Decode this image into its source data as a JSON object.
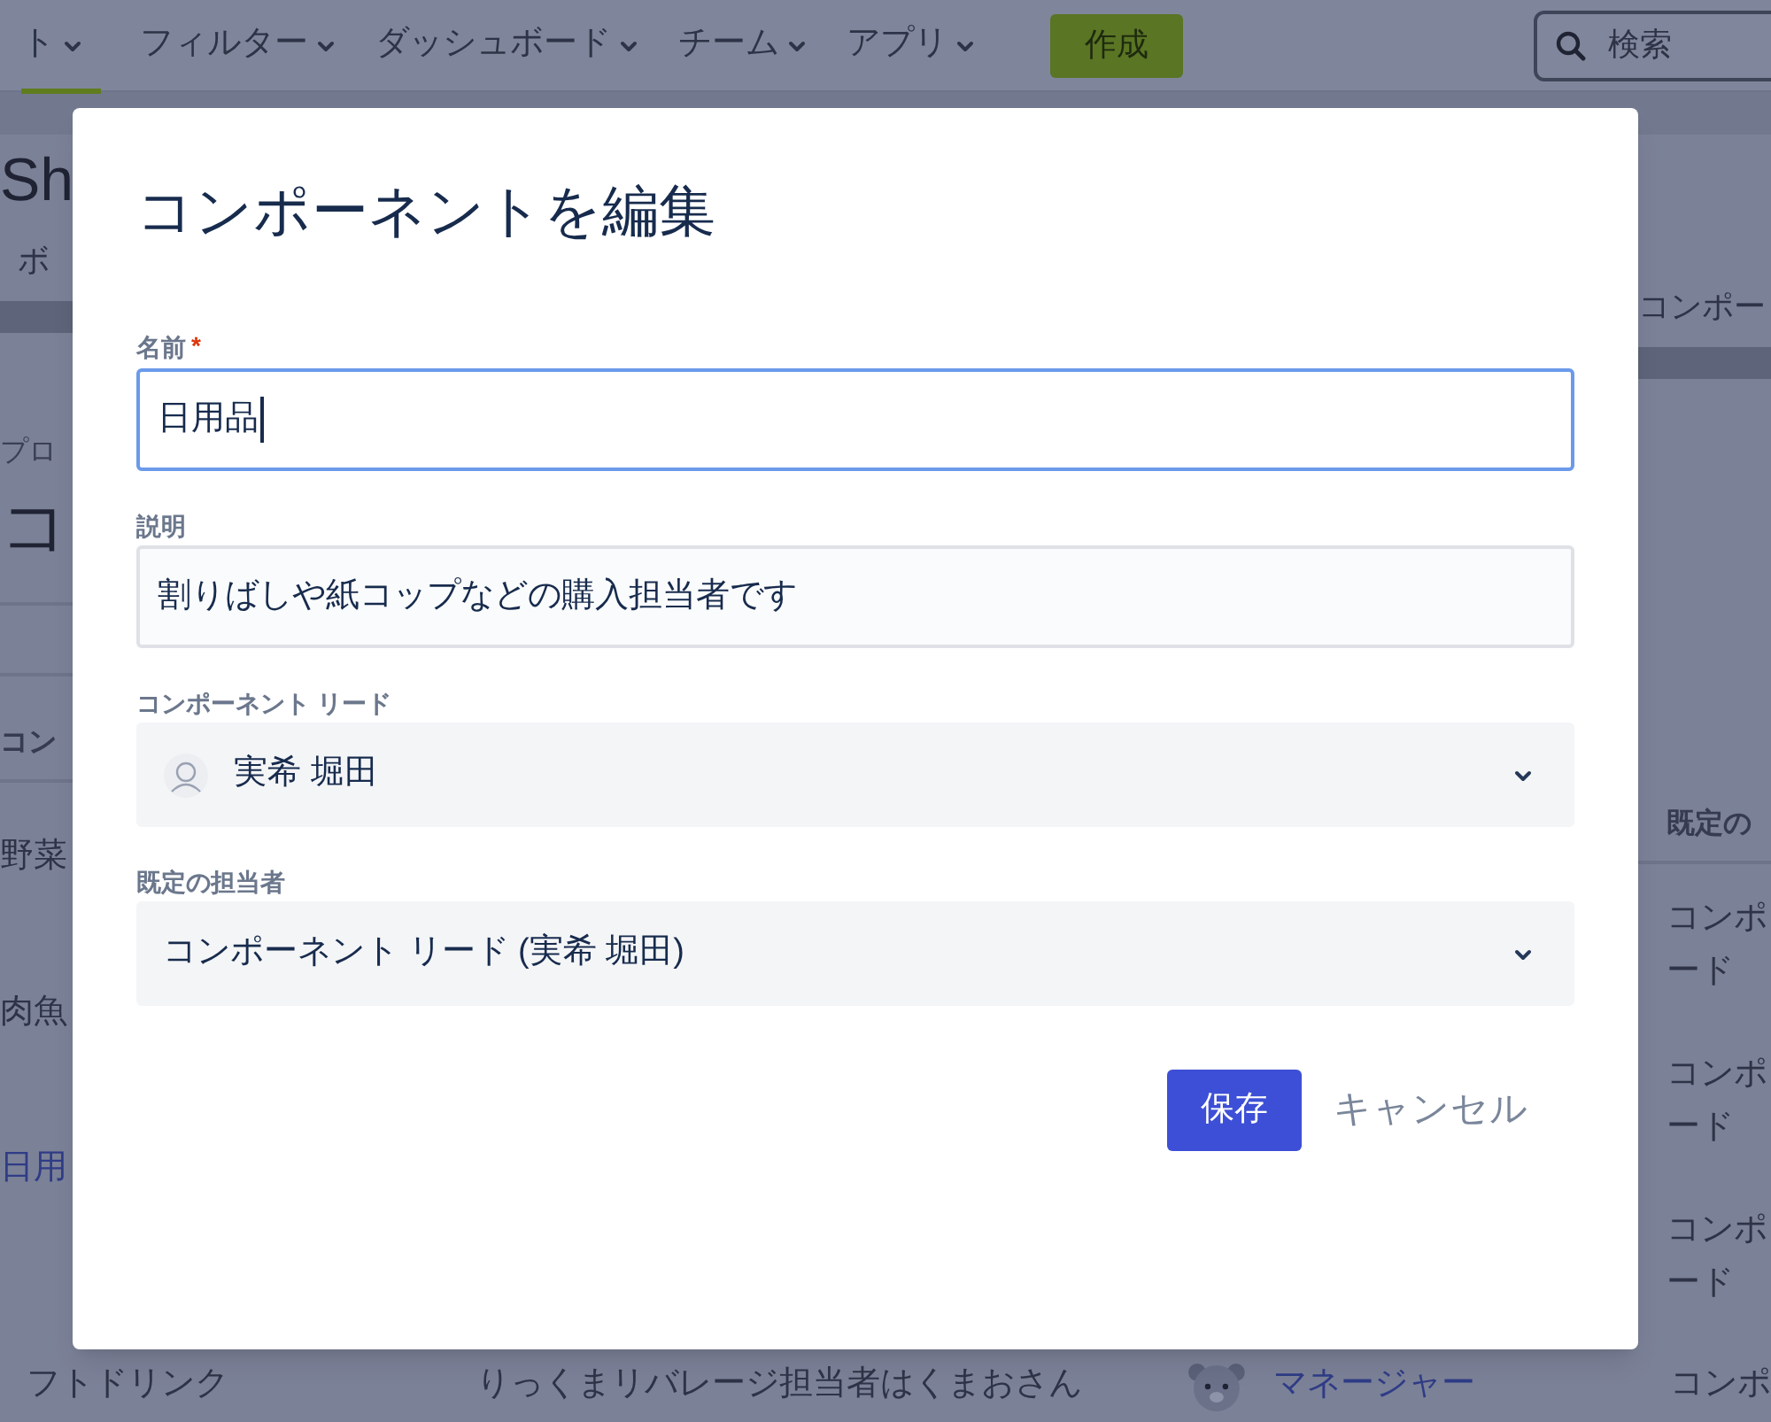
{
  "nav": {
    "items": [
      {
        "label": "ト",
        "selected": true
      },
      {
        "label": "フィルター",
        "selected": false
      },
      {
        "label": "ダッシュボード",
        "selected": false
      },
      {
        "label": "チーム",
        "selected": false
      },
      {
        "label": "アプリ",
        "selected": false
      }
    ],
    "create_button": "作成",
    "search": {
      "placeholder": "検索"
    }
  },
  "page": {
    "title": "Sh",
    "tab": "ボ",
    "right_tab": "コンポー",
    "breadcrumb": "プロ",
    "heading": "コ",
    "left_column": {
      "header": "コン",
      "cells": [
        {
          "text": "野菜",
          "link": false
        },
        {
          "text": "肉魚",
          "link": false
        },
        {
          "text": "日用",
          "link": true
        }
      ]
    },
    "right_column": {
      "header": "既定の",
      "cells": [
        {
          "lines": [
            "コンポ",
            "ード"
          ]
        },
        {
          "lines": [
            "コンポ",
            "ード"
          ]
        },
        {
          "lines": [
            "コンポ",
            "ード"
          ]
        }
      ]
    },
    "last_row": {
      "name": "フトドリンク",
      "description": "りっくまリバレージ担当者はくまおさん",
      "lead": "マネージャー",
      "assignee": "コンポ"
    }
  },
  "dialog": {
    "title": "コンポーネントを編集",
    "fields": [
      {
        "kind": "text",
        "label": "名前",
        "required_mark": "*",
        "value": "日用品",
        "focused": true
      },
      {
        "kind": "text",
        "label": "説明",
        "value": "割りばしや紙コップなどの購入担当者です",
        "focused": false
      },
      {
        "kind": "select",
        "label": "コンポーネント リード",
        "value": "実希 堀田",
        "avatar": true
      },
      {
        "kind": "select",
        "label": "既定の担当者",
        "value": "コンポーネント リード (実希 堀田)",
        "avatar": false
      }
    ],
    "save_button": "保存",
    "cancel_button": "キャンセル"
  }
}
